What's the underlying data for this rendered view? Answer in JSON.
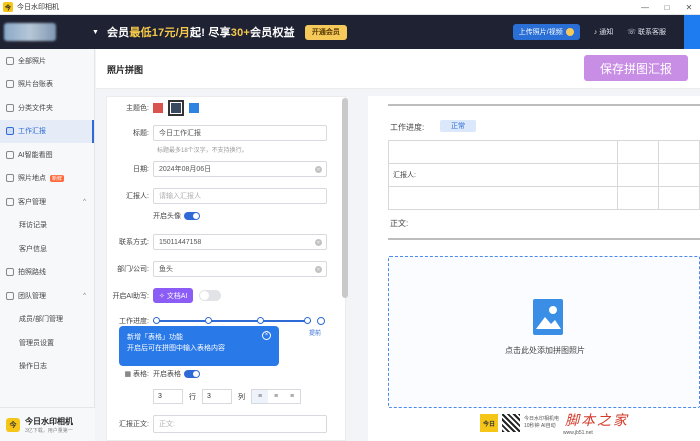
{
  "window": {
    "title": "今日水印相机",
    "minimize": "—",
    "maximize": "□",
    "close": "✕"
  },
  "header": {
    "promo_prefix": "会员",
    "promo_highlight1": "最低17元/月",
    "promo_mid": "起! 尽享",
    "promo_highlight2": "30+",
    "promo_suffix": "会员权益",
    "open_vip": "开通会员",
    "upload": "上传照片/视频",
    "notify": "通知",
    "support": "联系客服"
  },
  "sidebar": {
    "items": [
      {
        "label": "全部照片",
        "icon": "photo-icon"
      },
      {
        "label": "照片台账表",
        "icon": "table-icon"
      },
      {
        "label": "分类文件夹",
        "icon": "folder-icon"
      },
      {
        "label": "工作汇报",
        "icon": "report-icon",
        "active": true
      },
      {
        "label": "AI智能看图",
        "icon": "ai-icon"
      },
      {
        "label": "照片地点",
        "icon": "location-icon",
        "badge": "新鲜"
      },
      {
        "label": "客户管理",
        "icon": "customer-icon",
        "arrow": "^"
      },
      {
        "label": "拜访记录",
        "sub": true
      },
      {
        "label": "客户信息",
        "sub": true
      },
      {
        "label": "拍照路线",
        "icon": "route-icon"
      },
      {
        "label": "团队管理",
        "icon": "team-icon",
        "arrow": "^"
      },
      {
        "label": "成员/部门管理",
        "sub": true
      },
      {
        "label": "管理员设置",
        "sub": true
      },
      {
        "label": "操作日志",
        "sub": true
      }
    ],
    "brand_name": "今日水印相机",
    "brand_sub": "3亿下载，用户量第一"
  },
  "page": {
    "title": "照片拼图",
    "save": "保存拼图汇报"
  },
  "form": {
    "theme_label": "主题色:",
    "theme_colors": [
      "#d9534f",
      "#3a4a5e",
      "#2f83e0"
    ],
    "title_label": "标题:",
    "title_value": "今日工作汇报",
    "title_hint": "标题最多18个汉字，不支持换行。",
    "date_label": "日期:",
    "date_value": "2024年08月06日",
    "reporter_label": "汇报人:",
    "reporter_placeholder": "请输入汇报人",
    "show_avatar": "开启头像",
    "contact_label": "联系方式:",
    "contact_value": "15011447158",
    "dept_label": "部门/公司:",
    "dept_value": "鱼头",
    "ai_label": "开启AI助写:",
    "ai_button": "文档AI",
    "progress_label": "工作进度:",
    "progress_end": "提前",
    "tooltip_line1": "新增「表格」功能",
    "tooltip_line2": "开启后可在拼图中输入表格内容",
    "table_label": "表格:",
    "table_toggle": "开启表格",
    "rows_value": "3",
    "rows_unit": "行",
    "cols_value": "3",
    "cols_unit": "列",
    "align": [
      "≡",
      "≡",
      "≡"
    ],
    "body_label": "汇报正文:",
    "body_placeholder": "正文:"
  },
  "preview": {
    "progress_label": "工作进度:",
    "progress_status": "正常",
    "table_cells": [
      [
        "",
        "",
        ""
      ],
      [
        "汇报人:",
        "",
        ""
      ],
      [
        "",
        "",
        ""
      ]
    ],
    "body_label": "正文:",
    "drop_text": "点击此处添加拼图照片"
  },
  "watermark": {
    "logo": "今日",
    "text1": "今日水印相机电",
    "text2": "10秒钟 AI自动",
    "site": "脚本之家",
    "site_url": "www.jb51.net"
  }
}
